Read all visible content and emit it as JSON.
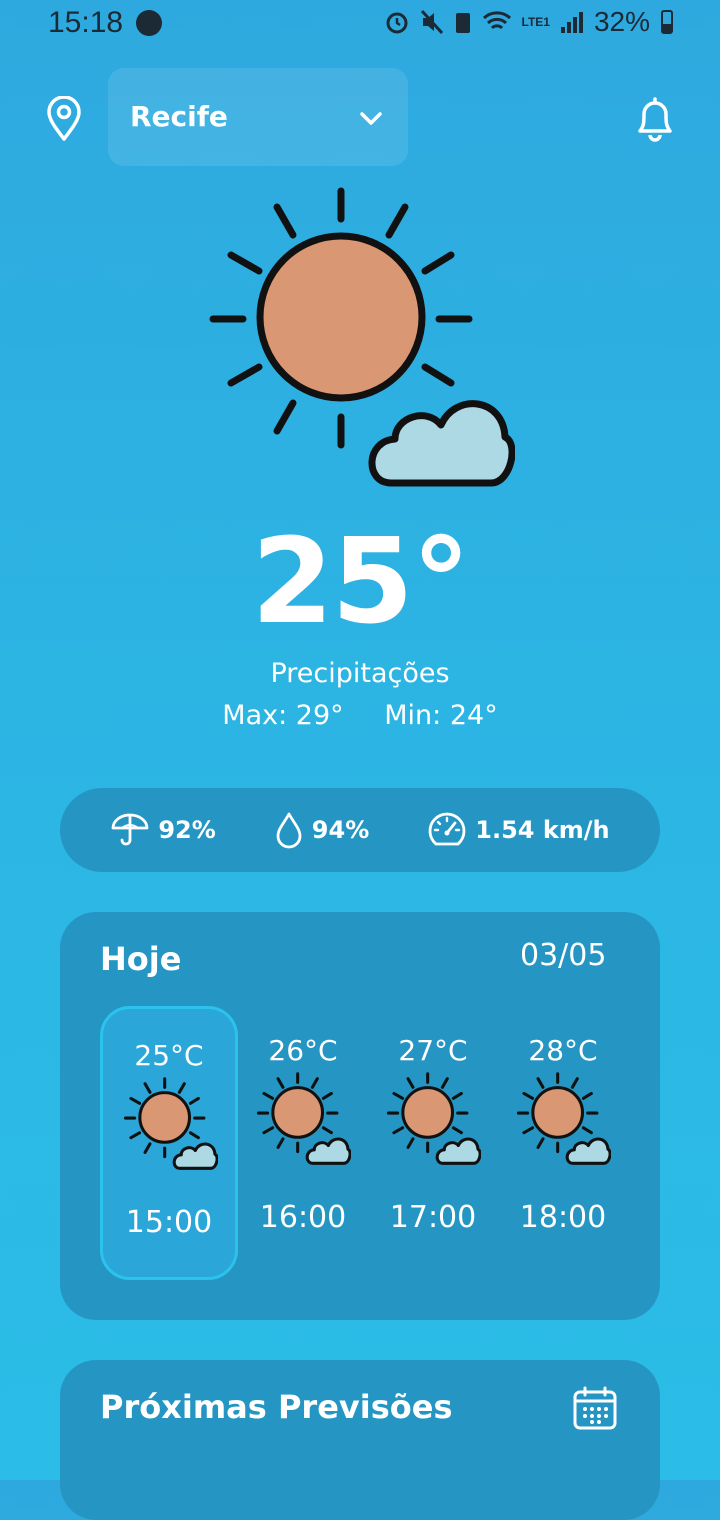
{
  "status": {
    "time": "15:18",
    "battery": "32%",
    "network": "LTE1"
  },
  "header": {
    "city": "Recife"
  },
  "current": {
    "temperature": "25°",
    "condition": "Precipitações",
    "max": "Max: 29°",
    "min": "Min: 24°"
  },
  "stats": {
    "rain": "92%",
    "humidity": "94%",
    "wind": "1.54 km/h"
  },
  "today": {
    "title": "Hoje",
    "date": "03/05",
    "hours": [
      {
        "temp": "25°C",
        "time": "15:00"
      },
      {
        "temp": "26°C",
        "time": "16:00"
      },
      {
        "temp": "27°C",
        "time": "17:00"
      },
      {
        "temp": "28°C",
        "time": "18:00"
      }
    ]
  },
  "next": {
    "title": "Próximas Previsões"
  },
  "colors": {
    "sun": "#d99873",
    "cloud": "#acd9e4",
    "card": "#2596c4"
  }
}
